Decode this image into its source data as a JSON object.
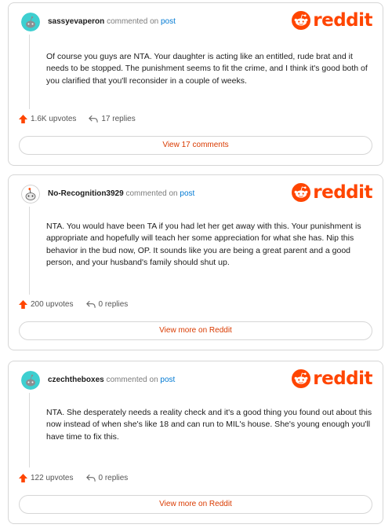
{
  "brand": {
    "name": "reddit",
    "color": "#ff4500"
  },
  "comments": [
    {
      "username": "sassyevaperon",
      "commented_text": "commented on",
      "post_link": "post",
      "text": "Of course you guys are NTA. Your daughter is acting like an entitled, rude brat and it needs to be stopped. The punishment seems to fit the crime, and I think it's good both of you clarified that you'll reconsider in a couple of weeks.",
      "upvotes": "1.6K upvotes",
      "replies": "17 replies",
      "button": "View 17 comments",
      "avatar": "snoo-avatar-teal"
    },
    {
      "username": "No-Recognition3929",
      "commented_text": "commented on",
      "post_link": "post",
      "text": "NTA. You would have been TA if you had let her get away with this. Your punishment is appropriate and hopefully will teach her some appreciation for what she has. Nip this behavior in the bud now, OP. It sounds like you are being a great parent and a good person, and your husband's family should shut up.",
      "upvotes": "200 upvotes",
      "replies": "0 replies",
      "button": "View more on Reddit",
      "avatar": "snoo-avatar-white"
    },
    {
      "username": "czechtheboxes",
      "commented_text": "commented on",
      "post_link": "post",
      "text": "NTA. She desperately needs a reality check and it's a good thing you found out about this now instead of when she's like 18 and can run to MIL's house. She's young enough you'll have time to fix this.",
      "upvotes": "122 upvotes",
      "replies": "0 replies",
      "button": "View more on Reddit",
      "avatar": "snoo-avatar-teal"
    }
  ]
}
